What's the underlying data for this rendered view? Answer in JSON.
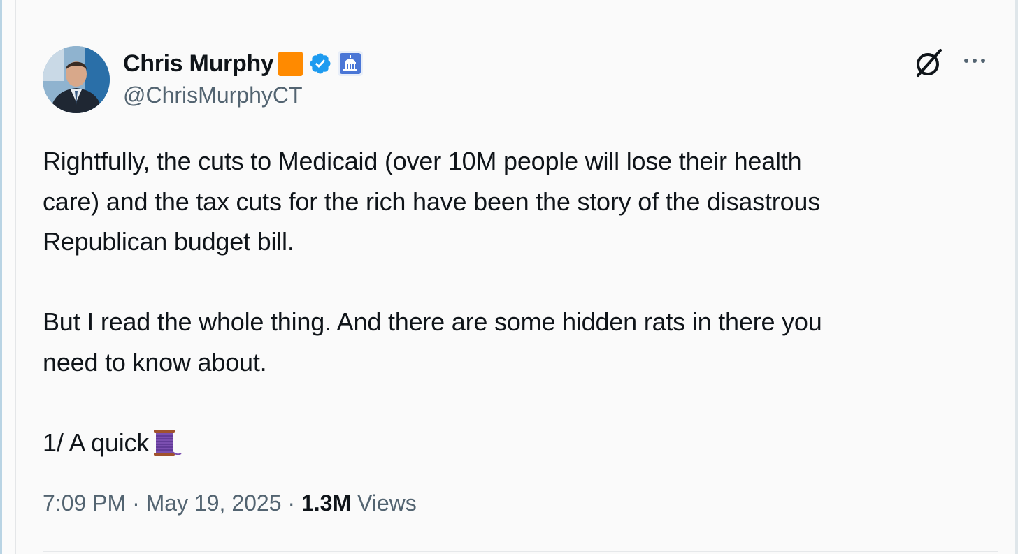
{
  "author": {
    "display_name": "Chris Murphy",
    "handle": "@ChrisMurphyCT",
    "badges": [
      "orange-square-emoji",
      "verified-badge-icon",
      "capitol-building-icon"
    ]
  },
  "header_actions": {
    "grok_icon": "grok-icon",
    "more_icon": "more-options-icon"
  },
  "tweet": {
    "paragraph1_line1": "Rightfully, the cuts to Medicaid (over 10M people will lose their health",
    "paragraph1_line2": "care) and the tax cuts for the rich have been the story of the disastrous",
    "paragraph1_line3": "Republican budget bill.",
    "paragraph2_line1": "But I read the whole thing. And there are some hidden rats in there you",
    "paragraph2_line2": "need to know about.",
    "paragraph3": "1/ A quick",
    "thread_emoji": "spool-of-thread-icon"
  },
  "meta": {
    "time": "7:09 PM",
    "separator": "·",
    "date": "May 19, 2025",
    "views_count": "1.3M",
    "views_label": "Views"
  },
  "colors": {
    "text_primary": "#0f1419",
    "text_secondary": "#536471",
    "verified_blue": "#1d9bf0",
    "orange_badge": "#ff8a00"
  }
}
